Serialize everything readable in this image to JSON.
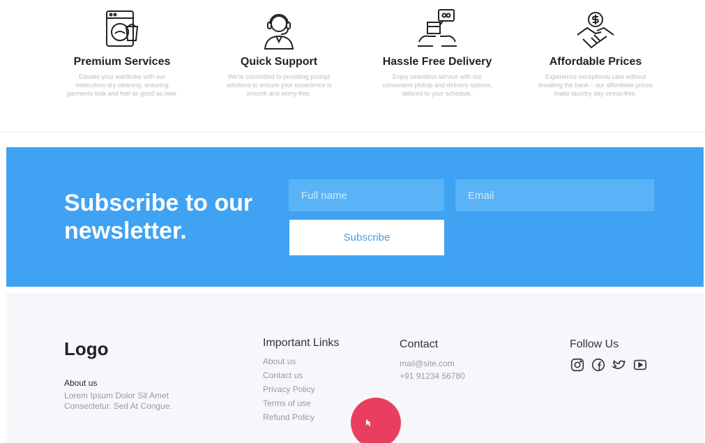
{
  "features": [
    {
      "title": "Premium Services",
      "description": "Elevate your wardrobe with our meticulous dry cleaning, ensuring garments look and feel as good as new.",
      "icon": "washing-machine-icon"
    },
    {
      "title": "Quick Support",
      "description": "We're committed to providing prompt solutions to ensure your experience is smooth and worry-free.",
      "icon": "support-agent-icon"
    },
    {
      "title": "Hassle Free Delivery",
      "description": "Enjoy seamless service with our convenient pickup and delivery options, tailored to your schedule.",
      "icon": "delivery-icon"
    },
    {
      "title": "Affordable Prices",
      "description": "Experience exceptional care without breaking the bank – our affordable prices make laundry day stress-free.",
      "icon": "price-hand-icon"
    }
  ],
  "newsletter": {
    "title": "Subscribe to our newsletter.",
    "fullname_placeholder": "Full name",
    "email_placeholder": "Email",
    "button_label": "Subscribe",
    "bg_color": "#3fa2f3"
  },
  "footer": {
    "logo": "Logo",
    "about_heading": "About us",
    "about_text": "Lorem Ipsum Dolor Sit Amet Consectetur. Sed At Congue.",
    "links_title": "Important Links",
    "links": [
      "About us",
      "Contact us",
      "Privacy Policy",
      "Terms of use",
      "Refund Policy"
    ],
    "contact_title": "Contact",
    "contact_email": "mail@site.com",
    "contact_phone": "+91 91234 56780",
    "follow_title": "Follow Us",
    "socials": [
      "instagram-icon",
      "facebook-icon",
      "twitter-icon",
      "youtube-icon"
    ]
  },
  "cursor_color": "#ea3e5e"
}
